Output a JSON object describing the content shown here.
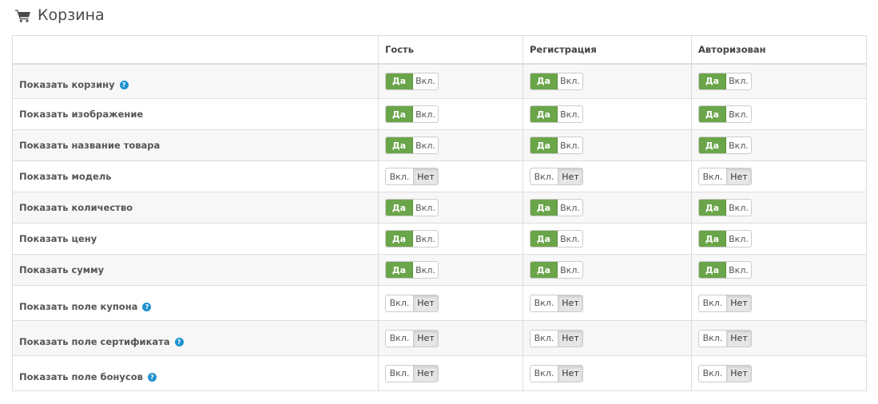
{
  "header": {
    "title": "Корзина",
    "icon": "shopping-cart-icon"
  },
  "table": {
    "columns": [
      "",
      "Гость",
      "Регистрация",
      "Авторизован"
    ],
    "rows": [
      {
        "label": "Показать корзину",
        "help": true,
        "values": [
          "on",
          "on",
          "on"
        ]
      },
      {
        "label": "Показать изображение",
        "help": false,
        "values": [
          "on",
          "on",
          "on"
        ]
      },
      {
        "label": "Показать название товара",
        "help": false,
        "values": [
          "on",
          "on",
          "on"
        ]
      },
      {
        "label": "Показать модель",
        "help": false,
        "values": [
          "off",
          "off",
          "off"
        ]
      },
      {
        "label": "Показать количество",
        "help": false,
        "values": [
          "on",
          "on",
          "on"
        ]
      },
      {
        "label": "Показать цену",
        "help": false,
        "values": [
          "on",
          "on",
          "on"
        ]
      },
      {
        "label": "Показать сумму",
        "help": false,
        "values": [
          "on",
          "on",
          "on"
        ]
      },
      {
        "label": "Показать поле купона",
        "help": true,
        "values": [
          "off",
          "off",
          "off"
        ]
      },
      {
        "label": "Показать поле сертификата",
        "help": true,
        "values": [
          "off",
          "off",
          "off"
        ]
      },
      {
        "label": "Показать поле бонусов",
        "help": true,
        "values": [
          "off",
          "off",
          "off"
        ]
      }
    ]
  },
  "toggle_labels": {
    "on_state": [
      "Да",
      "Вкл."
    ],
    "off_state": [
      "Вкл.",
      "Нет"
    ]
  },
  "help_glyph": "?",
  "colors": {
    "accent_green": "#6aa54a",
    "help_blue": "#1e91cf"
  }
}
